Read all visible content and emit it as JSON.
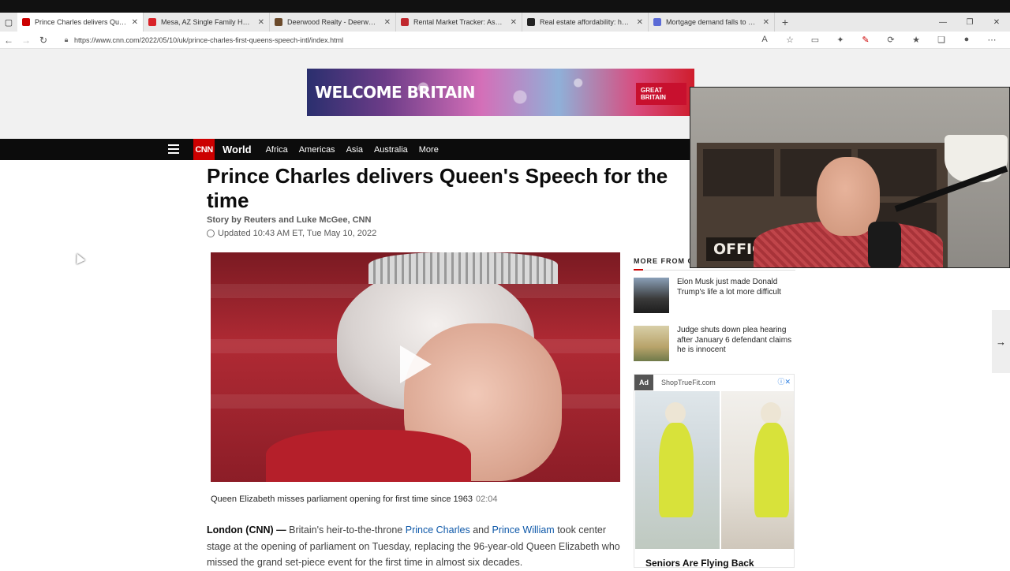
{
  "browser": {
    "tabs": [
      {
        "title": "Prince Charles delivers Queen's S",
        "favicon_color": "#cc0000",
        "active": true
      },
      {
        "title": "Mesa, AZ Single Family Homes f",
        "favicon_color": "#d92228",
        "active": false
      },
      {
        "title": "Deerwood Realty - Deerwood Dr",
        "favicon_color": "#6b4a2b",
        "active": false
      },
      {
        "title": "Rental Market Tracker: Asking Re",
        "favicon_color": "#c0272d",
        "active": false
      },
      {
        "title": "Real estate affordability: homeb",
        "favicon_color": "#222222",
        "active": false
      },
      {
        "title": "Mortgage demand falls to nearly",
        "favicon_color": "#5b6bd6",
        "active": false
      }
    ],
    "url": "https://www.cnn.com/2022/05/10/uk/prince-charles-first-queens-speech-intl/index.html"
  },
  "banner": {
    "welcome_text": "WELCOME BRITAIN",
    "badge_text": "GREAT BRITAIN"
  },
  "cnn_nav": {
    "logo": "CNN",
    "section": "World",
    "links": [
      "Africa",
      "Americas",
      "Asia",
      "Australia",
      "More"
    ]
  },
  "article": {
    "headline": "Prince Charles delivers Queen's Speech for the first time",
    "headline_visible": "Prince Charles delivers Queen's Speech for the\ntime",
    "byline": "Story by Reuters and Luke McGee, CNN",
    "updated": "Updated 10:43 AM ET, Tue May 10, 2022",
    "video_caption": "Queen Elizabeth misses parliament opening for first time since 1963",
    "video_duration": "02:04",
    "dateline": "London (CNN) —",
    "body_part1": " Britain's heir-to-the-throne ",
    "link1": "Prince Charles",
    "body_and": " and ",
    "link2": "Prince William",
    "body_part2": " took center stage at the opening of parliament on Tuesday, replacing the 96-year-old Queen Elizabeth who missed the grand set-piece event for the first time in almost six decades."
  },
  "sidebar": {
    "heading": "MORE FROM C",
    "items": [
      {
        "title": "Elon Musk just made Donald Trump's life a lot more difficult",
        "thumb_color": "#3a3a3a"
      },
      {
        "title": "Judge shuts down plea hearing after January 6 defendant claims he is innocent",
        "thumb_color": "#b8a36a"
      }
    ],
    "ad": {
      "tag": "Ad",
      "source": "ShopTrueFit.com",
      "headline": "Seniors Are Flying Back"
    }
  },
  "webcam": {
    "sign_text": "OFFICE"
  }
}
